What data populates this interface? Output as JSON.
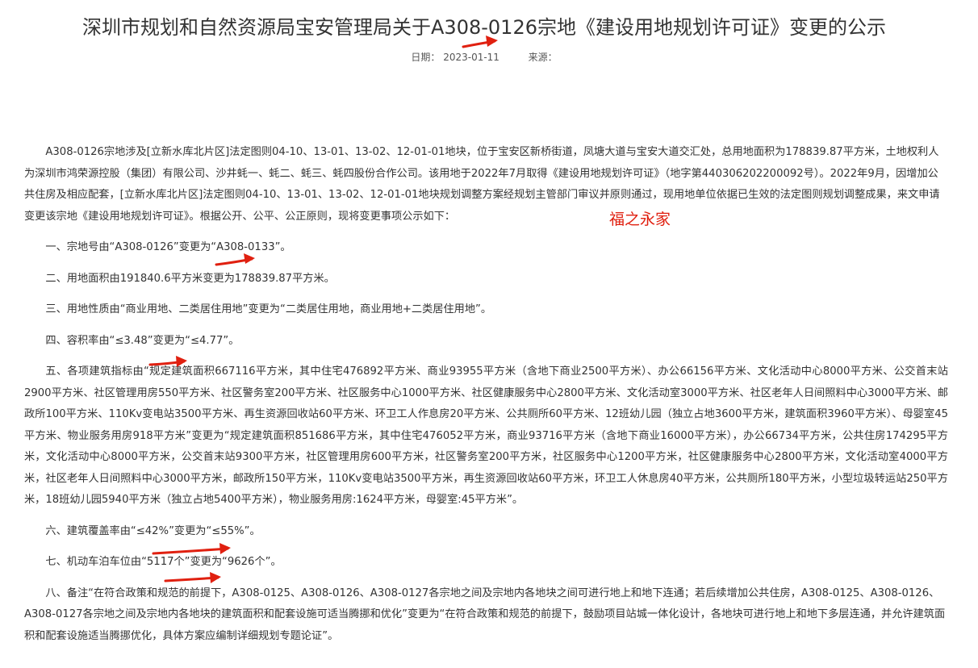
{
  "title": "深圳市规划和自然资源局宝安管理局关于A308-0126宗地《建设用地规划许可证》变更的公示",
  "meta": {
    "date_label": "日期：",
    "date": "2023-01-11",
    "source_label": "来源："
  },
  "annotation_text": "福之永家",
  "annotation_color": "#e02010",
  "paragraphs": {
    "intro": "A308-0126宗地涉及[立新水库北片区]法定图则04-10、13-01、13-02、12-01-01地块，位于宝安区新桥街道，凤塘大道与宝安大道交汇处，总用地面积为178839.87平方米，土地权利人为深圳市鸿荣源控股（集团）有限公司、沙井蚝一、蚝二、蚝三、蚝四股份合作公司。该用地于2022年7月取得《建设用地规划许可证》（地字第440306202200092号）。2022年9月，因增加公共住房及相应配套，[立新水库北片区]法定图则04-10、13-01、13-02、12-01-01地块规划调整方案经规划主管部门审议并原则通过，现用地单位依据已生效的法定图则规划调整成果，来文申请变更该宗地《建设用地规划许可证》。根据公开、公平、公正原则，现将变更事项公示如下：",
    "item1": "一、宗地号由“A308-0126”变更为“A308-0133”。",
    "item2": "二、用地面积由191840.6平方米变更为178839.87平方米。",
    "item3": "三、用地性质由“商业用地、二类居住用地”变更为“二类居住用地，商业用地+二类居住用地”。",
    "item4": "四、容积率由“≤3.48”变更为“≤4.77”。",
    "item5": "五、各项建筑指标由“规定建筑面积667116平方米，其中住宅476892平方米、商业93955平方米（含地下商业2500平方米）、办公66156平方米、文化活动中心8000平方米、公交首末站2900平方米、社区管理用房550平方米、社区警务室200平方米、社区服务中心1000平方米、社区健康服务中心2800平方米、文化活动室3000平方米、社区老年人日间照料中心3000平方米、邮政所100平方米、110Kv变电站3500平方米、再生资源回收站60平方米、环卫工人作息房20平方米、公共厕所60平方米、12班幼儿园（独立占地3600平方米，建筑面积3960平方米）、母婴室45平方米、物业服务用房918平方米”变更为“规定建筑面积851686平方米，其中住宅476052平方米，商业93716平方米（含地下商业16000平方米），办公66734平方米，公共住房174295平方米，文化活动中心8000平方米，公交首末站9300平方米，社区管理用房600平方米，社区警务室200平方米，社区服务中心1200平方米，社区健康服务中心2800平方米，文化活动室4000平方米，社区老年人日间照料中心3000平方米，邮政所150平方米，110Kv变电站3500平方米，再生资源回收站60平方米，环卫工人休息房40平方米，公共厕所180平方米，小型垃圾转运站250平方米，18班幼儿园5940平方米（独立占地5400平方米），物业服务用房:1624平方米，母婴室:45平方米”。",
    "item6": "六、建筑覆盖率由“≤42%”变更为“≤55%”。",
    "item7": "七、机动车泊车位由“5117个”变更为“9626个”。",
    "item8": "八、备注“在符合政策和规范的前提下，A308-0125、A308-0126、A308-0127各宗地之间及宗地内各地块之间可进行地上和地下连通；若后续增加公共住房，A308-0125、A308-0126、A308-0127各宗地之间及宗地内各地块的建筑面积和配套设施可适当腾挪和优化”变更为“在符合政策和规范的前提下，鼓励项目站城一体化设计，各地块可进行地上和地下多层连通，并允许建筑面积和配套设施适当腾挪优化，具体方案应编制详细规划专题论证”。"
  }
}
